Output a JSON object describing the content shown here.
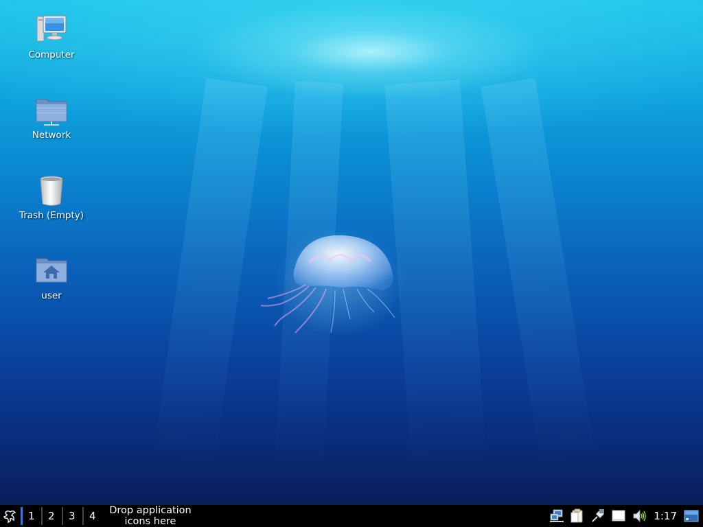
{
  "desktop": {
    "icons": [
      {
        "label": "Computer",
        "icon": "computer-icon"
      },
      {
        "label": "Network",
        "icon": "network-folder-icon"
      },
      {
        "label": "Trash (Empty)",
        "icon": "trash-icon"
      },
      {
        "label": "user",
        "icon": "home-folder-icon"
      }
    ]
  },
  "taskbar": {
    "start_icon": "distro-logo-icon",
    "workspaces": [
      "1",
      "2",
      "3",
      "4"
    ],
    "active_workspace": "1",
    "launcher_hint": "Drop application icons here",
    "tray": {
      "icons": [
        "network-tray-icon",
        "clipboard-tray-icon",
        "connection-tray-icon",
        "drive-tray-icon",
        "volume-icon"
      ],
      "clock": "1:17",
      "show_desktop_icon": "show-desktop-icon"
    }
  },
  "colors": {
    "taskbar_bg": "#000000",
    "active_workspace": "#3a78d8",
    "text": "#ffffff"
  }
}
